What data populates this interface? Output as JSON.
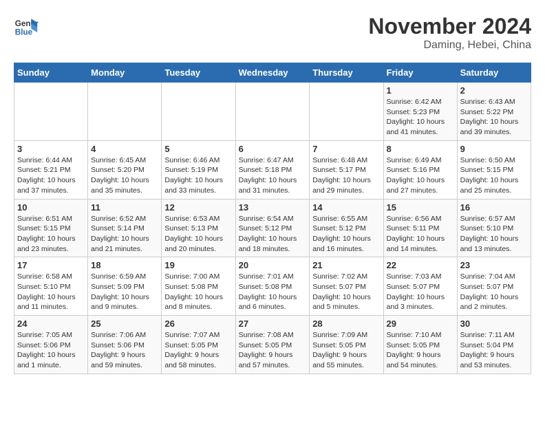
{
  "logo": {
    "line1": "General",
    "line2": "Blue"
  },
  "title": "November 2024",
  "subtitle": "Daming, Hebei, China",
  "header": {
    "colors": {
      "blue": "#2b6cb0"
    }
  },
  "days_of_week": [
    "Sunday",
    "Monday",
    "Tuesday",
    "Wednesday",
    "Thursday",
    "Friday",
    "Saturday"
  ],
  "weeks": [
    [
      {
        "day": "",
        "info": ""
      },
      {
        "day": "",
        "info": ""
      },
      {
        "day": "",
        "info": ""
      },
      {
        "day": "",
        "info": ""
      },
      {
        "day": "",
        "info": ""
      },
      {
        "day": "1",
        "info": "Sunrise: 6:42 AM\nSunset: 5:23 PM\nDaylight: 10 hours and 41 minutes."
      },
      {
        "day": "2",
        "info": "Sunrise: 6:43 AM\nSunset: 5:22 PM\nDaylight: 10 hours and 39 minutes."
      }
    ],
    [
      {
        "day": "3",
        "info": "Sunrise: 6:44 AM\nSunset: 5:21 PM\nDaylight: 10 hours and 37 minutes."
      },
      {
        "day": "4",
        "info": "Sunrise: 6:45 AM\nSunset: 5:20 PM\nDaylight: 10 hours and 35 minutes."
      },
      {
        "day": "5",
        "info": "Sunrise: 6:46 AM\nSunset: 5:19 PM\nDaylight: 10 hours and 33 minutes."
      },
      {
        "day": "6",
        "info": "Sunrise: 6:47 AM\nSunset: 5:18 PM\nDaylight: 10 hours and 31 minutes."
      },
      {
        "day": "7",
        "info": "Sunrise: 6:48 AM\nSunset: 5:17 PM\nDaylight: 10 hours and 29 minutes."
      },
      {
        "day": "8",
        "info": "Sunrise: 6:49 AM\nSunset: 5:16 PM\nDaylight: 10 hours and 27 minutes."
      },
      {
        "day": "9",
        "info": "Sunrise: 6:50 AM\nSunset: 5:15 PM\nDaylight: 10 hours and 25 minutes."
      }
    ],
    [
      {
        "day": "10",
        "info": "Sunrise: 6:51 AM\nSunset: 5:15 PM\nDaylight: 10 hours and 23 minutes."
      },
      {
        "day": "11",
        "info": "Sunrise: 6:52 AM\nSunset: 5:14 PM\nDaylight: 10 hours and 21 minutes."
      },
      {
        "day": "12",
        "info": "Sunrise: 6:53 AM\nSunset: 5:13 PM\nDaylight: 10 hours and 20 minutes."
      },
      {
        "day": "13",
        "info": "Sunrise: 6:54 AM\nSunset: 5:12 PM\nDaylight: 10 hours and 18 minutes."
      },
      {
        "day": "14",
        "info": "Sunrise: 6:55 AM\nSunset: 5:12 PM\nDaylight: 10 hours and 16 minutes."
      },
      {
        "day": "15",
        "info": "Sunrise: 6:56 AM\nSunset: 5:11 PM\nDaylight: 10 hours and 14 minutes."
      },
      {
        "day": "16",
        "info": "Sunrise: 6:57 AM\nSunset: 5:10 PM\nDaylight: 10 hours and 13 minutes."
      }
    ],
    [
      {
        "day": "17",
        "info": "Sunrise: 6:58 AM\nSunset: 5:10 PM\nDaylight: 10 hours and 11 minutes."
      },
      {
        "day": "18",
        "info": "Sunrise: 6:59 AM\nSunset: 5:09 PM\nDaylight: 10 hours and 9 minutes."
      },
      {
        "day": "19",
        "info": "Sunrise: 7:00 AM\nSunset: 5:08 PM\nDaylight: 10 hours and 8 minutes."
      },
      {
        "day": "20",
        "info": "Sunrise: 7:01 AM\nSunset: 5:08 PM\nDaylight: 10 hours and 6 minutes."
      },
      {
        "day": "21",
        "info": "Sunrise: 7:02 AM\nSunset: 5:07 PM\nDaylight: 10 hours and 5 minutes."
      },
      {
        "day": "22",
        "info": "Sunrise: 7:03 AM\nSunset: 5:07 PM\nDaylight: 10 hours and 3 minutes."
      },
      {
        "day": "23",
        "info": "Sunrise: 7:04 AM\nSunset: 5:07 PM\nDaylight: 10 hours and 2 minutes."
      }
    ],
    [
      {
        "day": "24",
        "info": "Sunrise: 7:05 AM\nSunset: 5:06 PM\nDaylight: 10 hours and 1 minute."
      },
      {
        "day": "25",
        "info": "Sunrise: 7:06 AM\nSunset: 5:06 PM\nDaylight: 9 hours and 59 minutes."
      },
      {
        "day": "26",
        "info": "Sunrise: 7:07 AM\nSunset: 5:05 PM\nDaylight: 9 hours and 58 minutes."
      },
      {
        "day": "27",
        "info": "Sunrise: 7:08 AM\nSunset: 5:05 PM\nDaylight: 9 hours and 57 minutes."
      },
      {
        "day": "28",
        "info": "Sunrise: 7:09 AM\nSunset: 5:05 PM\nDaylight: 9 hours and 55 minutes."
      },
      {
        "day": "29",
        "info": "Sunrise: 7:10 AM\nSunset: 5:05 PM\nDaylight: 9 hours and 54 minutes."
      },
      {
        "day": "30",
        "info": "Sunrise: 7:11 AM\nSunset: 5:04 PM\nDaylight: 9 hours and 53 minutes."
      }
    ]
  ]
}
